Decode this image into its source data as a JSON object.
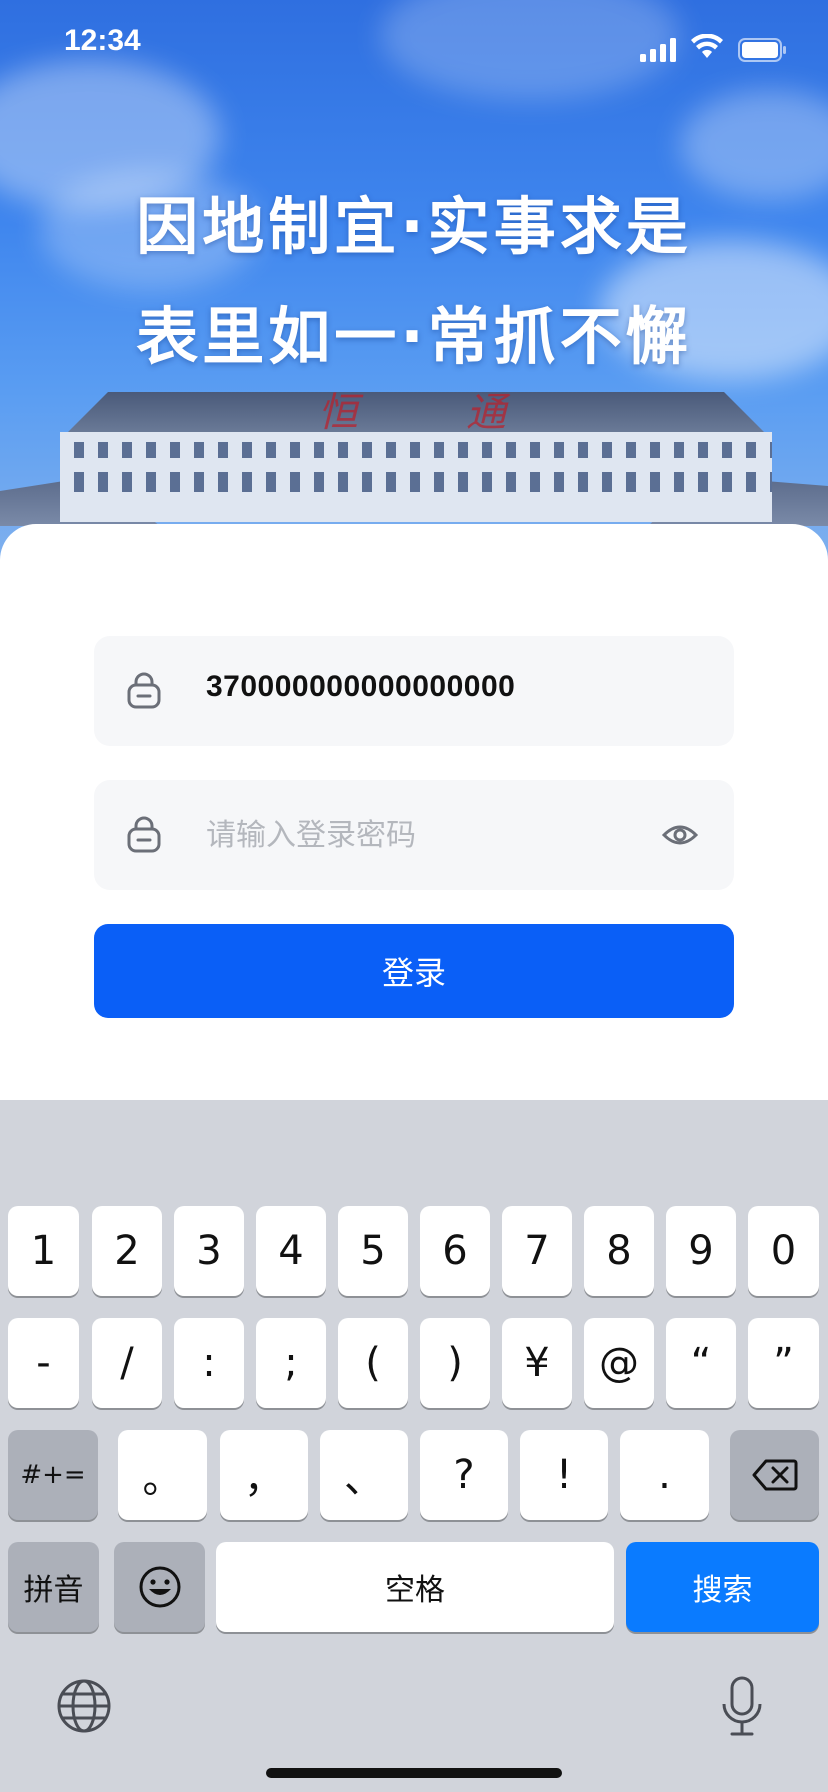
{
  "status_bar": {
    "time": "12:34"
  },
  "hero": {
    "slogan_line1": "因地制宜·实事求是",
    "slogan_line2": "表里如一·常抓不懈",
    "building_chars": [
      "恒",
      "通"
    ]
  },
  "form": {
    "username_value": "370000000000000000",
    "password_placeholder": "请输入登录密码",
    "login_label": "登录"
  },
  "keyboard": {
    "row1": [
      "1",
      "2",
      "3",
      "4",
      "5",
      "6",
      "7",
      "8",
      "9",
      "0"
    ],
    "row2": [
      "-",
      "/",
      ":",
      ";",
      "(",
      ")",
      "¥",
      "@",
      "“",
      "”"
    ],
    "row3_mode": "#+=",
    "row3": [
      "。",
      "，",
      "、",
      "?",
      "!",
      "."
    ],
    "pinyin_label": "拼音",
    "space_label": "空格",
    "search_label": "搜索"
  },
  "colors": {
    "primary": "#0a5ff7",
    "keyboard_return": "#0a7bff",
    "keyboard_bg": "#d1d4db",
    "field_bg": "#f6f7f9"
  }
}
